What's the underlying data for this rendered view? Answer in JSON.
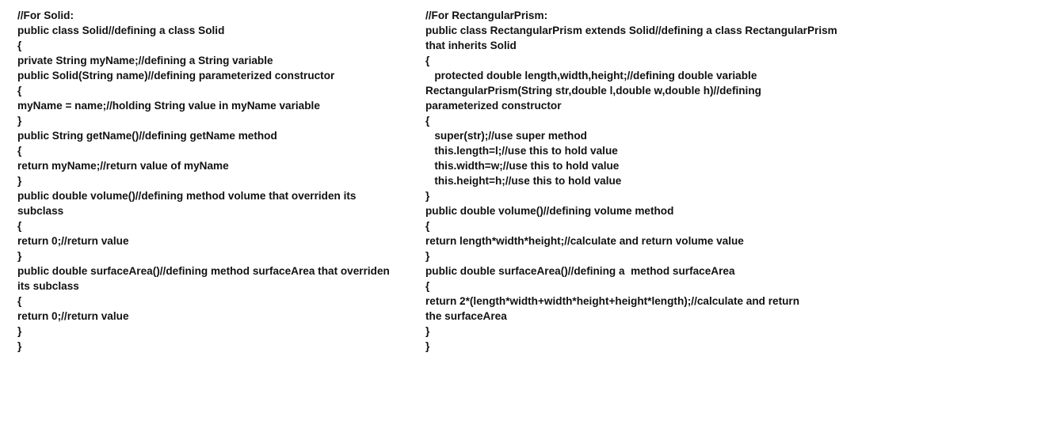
{
  "left_block": {
    "title": "//For Solid:",
    "lines": [
      "//For Solid:",
      "public class Solid//defining a class Solid",
      "{",
      "private String myName;//defining a String variable",
      "public Solid(String name)//defining parameterized constructor",
      "{",
      "myName = name;//holding String value in myName variable",
      "}",
      "public String getName()//defining getName method",
      "{",
      "return myName;//return value of myName",
      "}",
      "public double volume()//defining method volume that overriden its",
      "subclass",
      "{",
      "return 0;//return value",
      "}",
      "public double surfaceArea()//defining method surfaceArea that overriden",
      "its subclass",
      "{",
      "return 0;//return value",
      "}",
      "}"
    ]
  },
  "right_block": {
    "title": "//For RectangularPrism:",
    "lines": [
      "//For RectangularPrism:",
      "public class RectangularPrism extends Solid//defining a class RectangularPrism",
      "that inherits Solid",
      "{",
      "   protected double length,width,height;//defining double variable",
      "RectangularPrism(String str,double l,double w,double h)//defining",
      "parameterized constructor",
      "{",
      "   super(str);//use super method",
      "   this.length=l;//use this to hold value",
      "   this.width=w;//use this to hold value",
      "   this.height=h;//use this to hold value",
      "}",
      "public double volume()//defining volume method",
      "{",
      "return length*width*height;//calculate and return volume value",
      "}",
      "public double surfaceArea()//defining a  method surfaceArea",
      "{",
      "return 2*(length*width+width*height+height*length);//calculate and return",
      "the surfaceArea",
      "}",
      "}"
    ]
  }
}
